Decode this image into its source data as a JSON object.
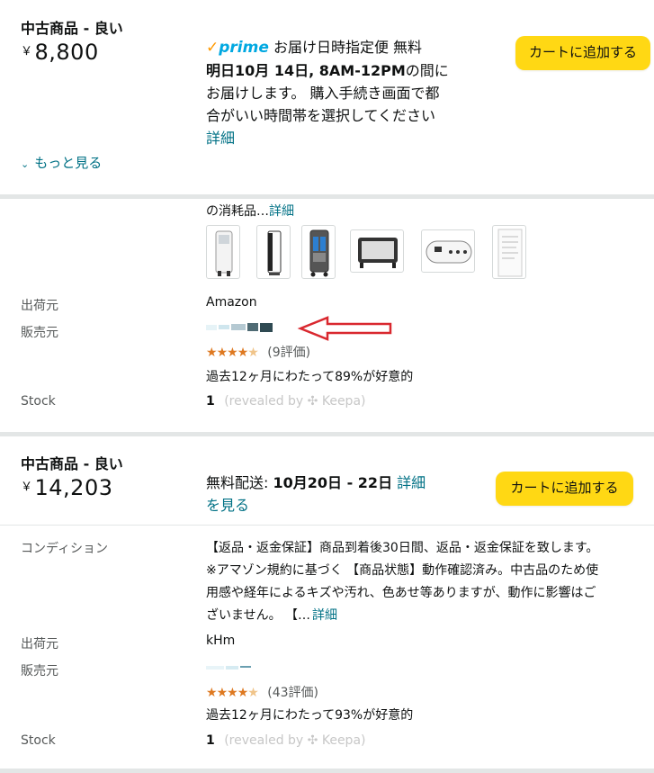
{
  "offer1": {
    "condition": "中古商品 - 良い",
    "currency": "￥",
    "price": "8,800",
    "prime_word": "prime",
    "delivery_line1": "お届け日時指定便 無料",
    "delivery_bold": "明日10月 14日, 8AM-12PM",
    "delivery_line2_rest": "の間に",
    "delivery_line3": "お届けします。 購入手続き画面で都",
    "delivery_line4": "合がいい時間帯を選択してください",
    "details_link": "詳細",
    "cart_button": "カートに追加する",
    "see_more": "もっと見る"
  },
  "offer2": {
    "description_tail": "の消耗品…",
    "details_link": "詳細",
    "thumbnails": [
      "air-cooler-front",
      "air-cooler-side",
      "air-cooler-back",
      "ice-packs",
      "remote-control",
      "manual-page"
    ],
    "ships_from_label": "出荷元",
    "ships_from_value": "Amazon",
    "sold_by_label": "販売元",
    "sold_by_value": "",
    "rating_stars": "★★★★★",
    "rating_count": "(9評価)",
    "positive_text": "過去12ヶ月にわたって89%が好意的",
    "stock_label": "Stock",
    "stock_value": "1",
    "keepa_note": "(revealed by ✣ Keepa)"
  },
  "offer3": {
    "condition": "中古商品 - 良い",
    "currency": "￥",
    "price": "14,203",
    "delivery_prefix": "無料配送: ",
    "delivery_bold": "10月20日 - 22日",
    "details_link": "詳細",
    "see_link": "を見る",
    "cart_button": "カートに追加する",
    "condition_label": "コンディション",
    "condition_text_1": "【返品・返金保証】商品到着後30日間、返品・返金保証を致します。",
    "condition_text_2": "※アマゾン規約に基づく 【商品状態】動作確認済み。中古品のため使",
    "condition_text_3": "用感や経年によるキズや汚れ、色あせ等ありますが、動作に影響はご",
    "condition_text_4": "ざいません。 【…",
    "condition_details_link": "詳細",
    "ships_from_label": "出荷元",
    "ships_from_value": "kHm",
    "sold_by_label": "販売元",
    "sold_by_value": "",
    "rating_stars": "★★★★★",
    "rating_count": "(43評価)",
    "positive_text": "過去12ヶ月にわたって93%が好意的",
    "stock_label": "Stock",
    "stock_value": "1",
    "keepa_note": "(revealed by ✣ Keepa)"
  },
  "colors": {
    "cart_yellow": "#ffd814",
    "link": "#007185",
    "star": "#de7921",
    "annotation_arrow": "#d9282f",
    "prime_blue": "#00a8e1"
  }
}
